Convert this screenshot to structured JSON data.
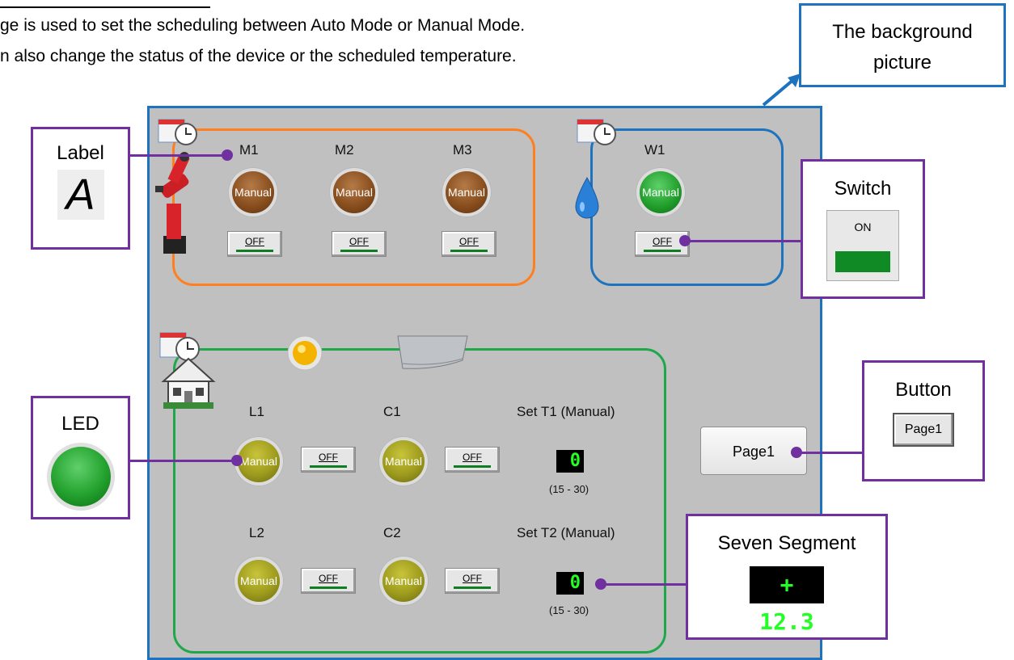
{
  "intro": {
    "line1": "ge is used to set the scheduling between Auto Mode or Manual Mode.",
    "line2": "n also change the status of the device or the scheduled temperature."
  },
  "callouts": {
    "background": "The background picture",
    "label": "Label",
    "label_sample": "A",
    "switch": "Switch",
    "switch_sample": "ON",
    "led": "LED",
    "button": "Button",
    "button_sample": "Page1",
    "seven_segment": "Seven Segment",
    "seven_segment_sample": "+ 12.3"
  },
  "machines": {
    "items": [
      {
        "label": "M1",
        "led": "Manual",
        "switch": "OFF"
      },
      {
        "label": "M2",
        "led": "Manual",
        "switch": "OFF"
      },
      {
        "label": "M3",
        "led": "Manual",
        "switch": "OFF"
      }
    ]
  },
  "water": {
    "label": "W1",
    "led": "Manual",
    "switch": "OFF"
  },
  "home": {
    "rows": [
      {
        "light": "L1",
        "cooler": "C1",
        "set": "Set T1 (Manual)",
        "value": "0",
        "range": "(15 - 30)"
      },
      {
        "light": "L2",
        "cooler": "C2",
        "set": "Set T2 (Manual)",
        "value": "0",
        "range": "(15 - 30)"
      }
    ],
    "led": "Manual",
    "switch": "OFF"
  },
  "page_button": "Page1",
  "colors": {
    "panel_border": "#1e73be",
    "machines_group": "#ff7f1f",
    "water_group": "#1e73be",
    "home_group": "#1ea84a",
    "callout_border": "#7030a0"
  }
}
